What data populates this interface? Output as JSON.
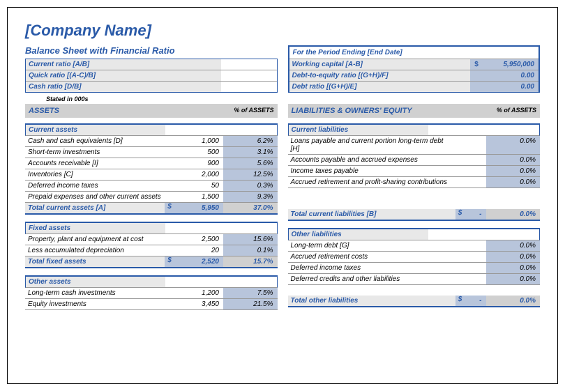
{
  "company_name": "[Company Name]",
  "sheet_title": "Balance Sheet with Financial Ratio",
  "period_title": "For the Period Ending [End Date]",
  "stated_in": "Stated in 000s",
  "pct_assets_label": "% of ASSETS",
  "assets_header": "ASSETS",
  "liab_header": "LIABILITIES & OWNERS' EQUITY",
  "left_ratios": [
    {
      "label": "Current ratio  [A/B]",
      "val": ""
    },
    {
      "label": "Quick ratio  [(A-C)/B]",
      "val": ""
    },
    {
      "label": "Cash ratio  [D/B]",
      "val": ""
    }
  ],
  "right_ratios": [
    {
      "label": "Working capital  [A-B]",
      "cur": "$",
      "val": "5,950,000"
    },
    {
      "label": "Debt-to-equity ratio  [(G+H)/F]",
      "cur": "",
      "val": "0.00"
    },
    {
      "label": "Debt ratio  [(G+H)/E]",
      "cur": "",
      "val": "0.00"
    }
  ],
  "current_assets": {
    "title": "Current assets",
    "rows": [
      {
        "label": "Cash and cash equivalents  [D]",
        "val": "1,000",
        "pct": "6.2%"
      },
      {
        "label": "Short-term investments",
        "val": "500",
        "pct": "3.1%"
      },
      {
        "label": "Accounts receivable  [I]",
        "val": "900",
        "pct": "5.6%"
      },
      {
        "label": "Inventories  [C]",
        "val": "2,000",
        "pct": "12.5%"
      },
      {
        "label": "Deferred income taxes",
        "val": "50",
        "pct": "0.3%"
      },
      {
        "label": "Prepaid expenses and other current assets",
        "val": "1,500",
        "pct": "9.3%"
      }
    ],
    "total": {
      "label": "Total current assets  [A]",
      "cur": "$",
      "val": "5,950",
      "pct": "37.0%"
    }
  },
  "fixed_assets": {
    "title": "Fixed assets",
    "rows": [
      {
        "label": "Property, plant and equipment at cost",
        "val": "2,500",
        "pct": "15.6%"
      },
      {
        "label": "Less accumulated depreciation",
        "val": "20",
        "pct": "0.1%"
      }
    ],
    "total": {
      "label": "Total fixed assets",
      "cur": "$",
      "val": "2,520",
      "pct": "15.7%"
    }
  },
  "other_assets": {
    "title": "Other assets",
    "rows": [
      {
        "label": "Long-term cash investments",
        "val": "1,200",
        "pct": "7.5%"
      },
      {
        "label": "Equity investments",
        "val": "3,450",
        "pct": "21.5%"
      }
    ]
  },
  "current_liab": {
    "title": "Current liabilities",
    "rows": [
      {
        "label": "Loans payable and current portion long-term debt  [H]",
        "val": "",
        "pct": "0.0%"
      },
      {
        "label": "Accounts payable and accrued expenses",
        "val": "",
        "pct": "0.0%"
      },
      {
        "label": "Income taxes payable",
        "val": "",
        "pct": "0.0%"
      },
      {
        "label": "Accrued retirement and profit-sharing contributions",
        "val": "",
        "pct": "0.0%"
      }
    ],
    "total": {
      "label": "Total current liabilities  [B]",
      "cur": "$",
      "val": "-",
      "pct": "0.0%"
    }
  },
  "other_liab": {
    "title": "Other liabilities",
    "rows": [
      {
        "label": "Long-term debt  [G]",
        "val": "",
        "pct": "0.0%"
      },
      {
        "label": "Accrued retirement costs",
        "val": "",
        "pct": "0.0%"
      },
      {
        "label": "Deferred income taxes",
        "val": "",
        "pct": "0.0%"
      },
      {
        "label": "Deferred credits and other liabilities",
        "val": "",
        "pct": "0.0%"
      }
    ],
    "total": {
      "label": "Total other liabilities",
      "cur": "$",
      "val": "-",
      "pct": "0.0%"
    }
  }
}
